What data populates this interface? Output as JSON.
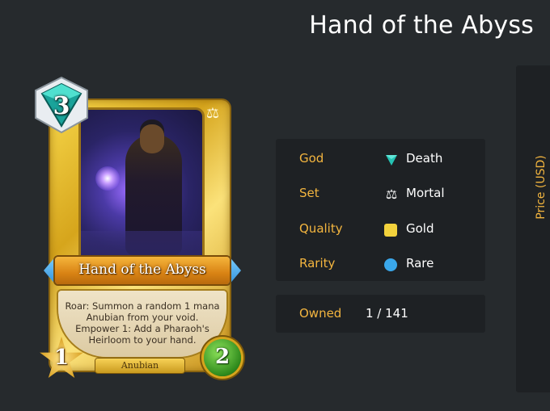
{
  "page": {
    "title": "Hand of the Abyss"
  },
  "card": {
    "name": "Hand of the Abyss",
    "mana": "3",
    "attack": "1",
    "health": "2",
    "tribe": "Anubian",
    "text": "Roar: Summon a random 1 mana Anubian from your void. Empower 1: Add a Pharaoh's Heirloom to your hand.",
    "god_icon": "death-triangle-icon",
    "set_icon": "scales-icon"
  },
  "details": {
    "god": {
      "label": "God",
      "value": "Death",
      "icon": "death-triangle-icon",
      "color": "#25c3b4"
    },
    "set": {
      "label": "Set",
      "value": "Mortal",
      "icon": "scales-icon"
    },
    "quality": {
      "label": "Quality",
      "value": "Gold",
      "icon": "gold-square-icon",
      "color": "#f3d23c"
    },
    "rarity": {
      "label": "Rarity",
      "value": "Rare",
      "icon": "rare-dot-icon",
      "color": "#3aa7ea"
    }
  },
  "owned": {
    "label": "Owned",
    "value": "1 / 141"
  },
  "price_panel": {
    "label": "Price (USD)"
  },
  "colors": {
    "background": "#262a2d",
    "panel": "#1e2124",
    "accent": "#f3b53f",
    "text": "#ffffff"
  }
}
